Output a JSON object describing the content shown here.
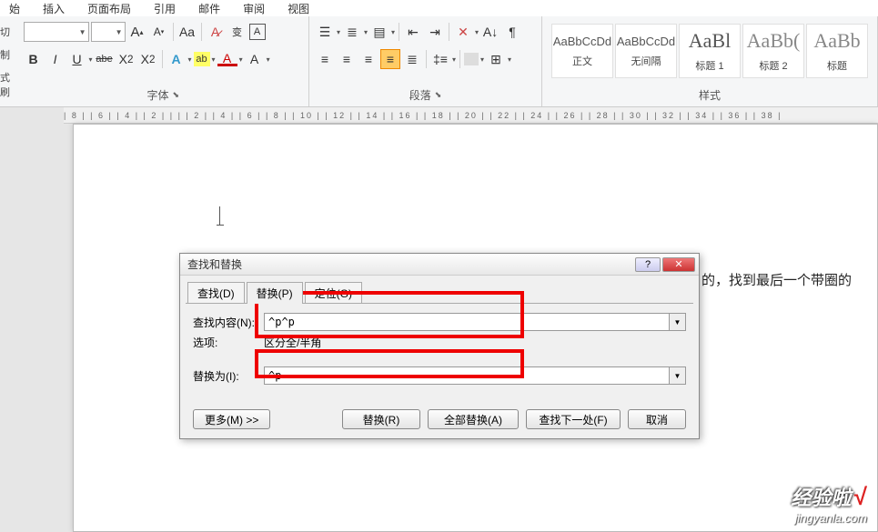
{
  "ribbon": {
    "tabs": [
      "始",
      "插入",
      "页面布局",
      "引用",
      "邮件",
      "审阅",
      "视图"
    ],
    "left_labels": [
      "切",
      "制",
      "式刷"
    ],
    "groups": {
      "font": {
        "label": "字体"
      },
      "paragraph": {
        "label": "段落"
      },
      "styles": {
        "label": "样式"
      }
    },
    "font_row": {
      "bold": "B",
      "italic": "I",
      "underline": "U",
      "strike": "abe",
      "sub": "X",
      "sup": "X"
    },
    "styles": [
      {
        "preview": "AaBbCcDd",
        "name": "正文"
      },
      {
        "preview": "AaBbCcDd",
        "name": "无间隔"
      },
      {
        "preview": "AaBl",
        "name": "标题 1"
      },
      {
        "preview": "AaBb(",
        "name": "标题 2"
      },
      {
        "preview": "AaBb",
        "name": "标题"
      }
    ]
  },
  "ruler": "| 8 | | 6 | | 4 | | 2 | | | | 2 | | 4 | | 6 | | 8 | | 10 | | 12 | | 14 | | 16 | | 18 | | 20 | | 22 | | 24 | | 26 | | 28 | | 30 | | 32 | | 34 | | 36 | | 38 |",
  "doc": {
    "visible_text": "的，找到最后一个带圈的"
  },
  "dialog": {
    "title": "查找和替换",
    "tabs": {
      "find": "查找(D)",
      "replace": "替换(P)",
      "goto": "定位(G)"
    },
    "find_label": "查找内容(N):",
    "find_value": "^p^p",
    "options_label": "选项:",
    "options_value": "区分全/半角",
    "replace_label": "替换为(I):",
    "replace_value": "^p",
    "buttons": {
      "more": "更多(M) >>",
      "replace": "替换(R)",
      "replace_all": "全部替换(A)",
      "find_next": "查找下一处(F)",
      "cancel": "取消"
    },
    "help": "?",
    "close": "✕"
  },
  "watermark": {
    "line1": "经验啦",
    "check": "√",
    "line2": "jingyanla.com"
  }
}
